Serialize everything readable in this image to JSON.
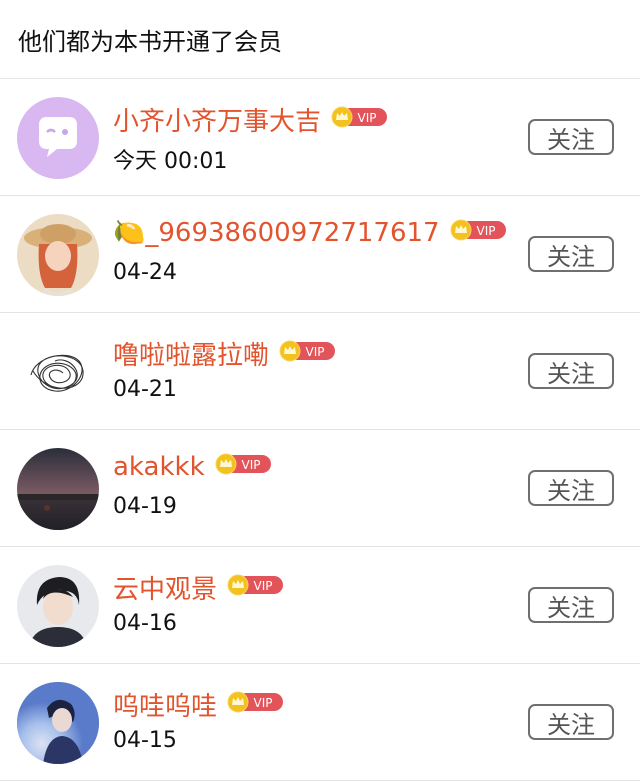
{
  "header": {
    "title": "他们都为本书开通了会员"
  },
  "colors": {
    "name": "#e1542e",
    "vip_badge": "#e2545a",
    "crown": "#f4c21f",
    "divider": "#e3e3e3"
  },
  "members": [
    {
      "name": "小齐小齐万事大吉",
      "time": "今天 00:01",
      "badge": "VIP",
      "follow_label": "关注",
      "avatar_icon": "chat-bubble-icon"
    },
    {
      "name": "🍋_96938600972717617",
      "time": "04-24",
      "badge": "VIP",
      "follow_label": "关注",
      "avatar_icon": "girl-straw-hat-avatar"
    },
    {
      "name": "噜啦啦露拉嘞",
      "time": "04-21",
      "badge": "VIP",
      "follow_label": "关注",
      "avatar_icon": "scribble-avatar"
    },
    {
      "name": "akakkk",
      "time": "04-19",
      "badge": "VIP",
      "follow_label": "关注",
      "avatar_icon": "sunset-landscape-avatar"
    },
    {
      "name": "云中观景",
      "time": "04-16",
      "badge": "VIP",
      "follow_label": "关注",
      "avatar_icon": "boy-portrait-avatar"
    },
    {
      "name": "呜哇呜哇",
      "time": "04-15",
      "badge": "VIP",
      "follow_label": "关注",
      "avatar_icon": "blue-glow-portrait-avatar"
    }
  ]
}
